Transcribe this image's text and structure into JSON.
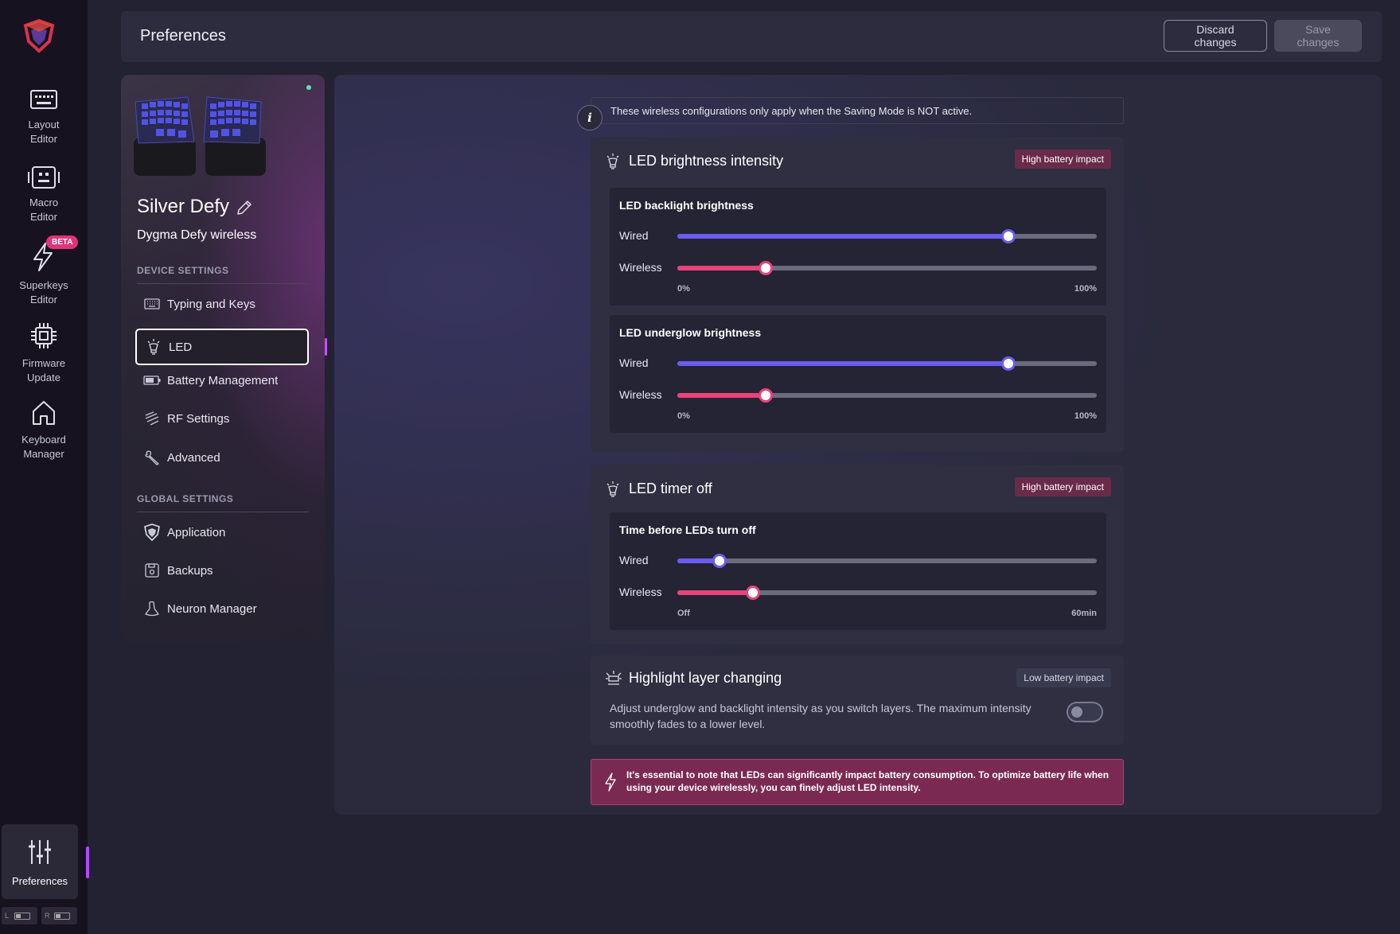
{
  "rail": {
    "items": [
      {
        "label_line1": "Layout",
        "label_line2": "Editor",
        "icon": "keyboard-icon"
      },
      {
        "label_line1": "Macro",
        "label_line2": "Editor",
        "icon": "macro-icon"
      },
      {
        "label_line1": "Superkeys",
        "label_line2": "Editor",
        "icon": "lightning-icon",
        "badge": "BETA"
      },
      {
        "label_line1": "Firmware",
        "label_line2": "Update",
        "icon": "chip-icon"
      },
      {
        "label_line1": "Keyboard",
        "label_line2": "Manager",
        "icon": "home-icon"
      }
    ],
    "preferences": {
      "label": "Preferences",
      "icon": "sliders-icon"
    },
    "battery": {
      "left": "L",
      "right": "R"
    }
  },
  "header": {
    "title": "Preferences",
    "discard_label": "Discard changes",
    "save_label": "Save changes"
  },
  "device": {
    "name": "Silver Defy",
    "model": "Dygma Defy wireless",
    "device_settings_title": "DEVICE SETTINGS",
    "global_settings_title": "GLOBAL SETTINGS",
    "menu": {
      "typing": "Typing and Keys",
      "led": "LED",
      "battery": "Battery Management",
      "rf": "RF Settings",
      "advanced": "Advanced",
      "application": "Application",
      "backups": "Backups",
      "neuron": "Neuron Manager"
    }
  },
  "info": {
    "icon_text": "i",
    "message": "These wireless configurations only apply when the Saving Mode is NOT active."
  },
  "brightness": {
    "title": "LED brightness intensity",
    "badge": "High battery impact",
    "backlight": {
      "title": "LED backlight brightness",
      "wired_label": "Wired",
      "wireless_label": "Wireless",
      "wired_value": 79,
      "wireless_value": 21,
      "min_label": "0%",
      "max_label": "100%"
    },
    "underglow": {
      "title": "LED underglow brightness",
      "wired_label": "Wired",
      "wireless_label": "Wireless",
      "wired_value": 79,
      "wireless_value": 21,
      "min_label": "0%",
      "max_label": "100%"
    }
  },
  "timer": {
    "title": "LED timer off",
    "badge": "High battery impact",
    "sub_title": "Time before LEDs turn off",
    "wired_label": "Wired",
    "wireless_label": "Wireless",
    "wired_value": 10,
    "wireless_value": 18,
    "min_label": "Off",
    "max_label": "60min"
  },
  "highlight": {
    "title": "Highlight layer changing",
    "badge": "Low battery impact",
    "description": "Adjust underglow and backlight intensity as you switch layers. The maximum intensity smoothly fades to a lower level.",
    "enabled": false
  },
  "warning": {
    "message": "It's essential to note that LEDs can significantly impact battery consumption. To optimize battery life when using your device wirelessly, you can finely adjust LED intensity."
  },
  "colors": {
    "wired_accent": "#6a5cf0",
    "wireless_accent": "#e8437a",
    "badge_high": "#6a2a4a",
    "warning_bg": "#7a2a52",
    "active_accent": "#c850ff"
  }
}
